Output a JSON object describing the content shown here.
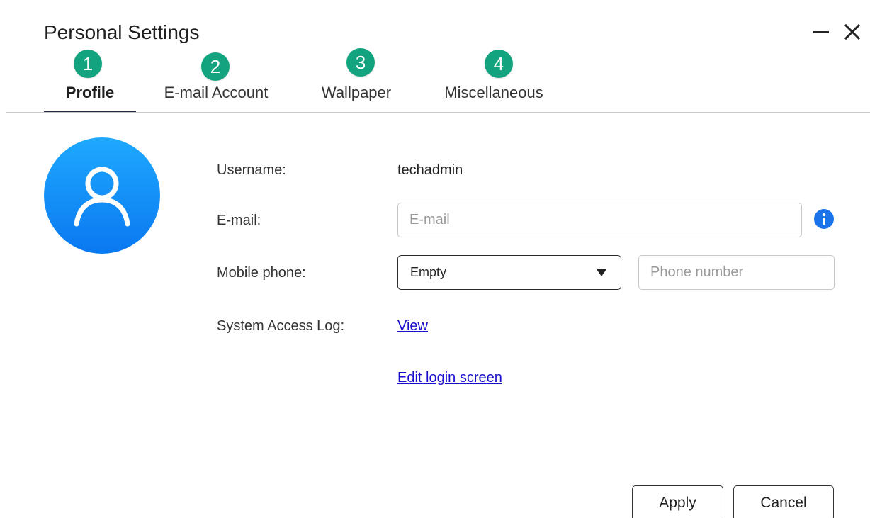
{
  "window": {
    "title": "Personal Settings"
  },
  "tabs": [
    {
      "label": "Profile",
      "marker": "1",
      "active": true
    },
    {
      "label": "E-mail Account",
      "marker": "2",
      "active": false
    },
    {
      "label": "Wallpaper",
      "marker": "3",
      "active": false
    },
    {
      "label": "Miscellaneous",
      "marker": "4",
      "active": false
    }
  ],
  "profile": {
    "username_label": "Username:",
    "username_value": "techadmin",
    "email_label": "E-mail:",
    "email_value": "",
    "email_placeholder": "E-mail",
    "mobile_label": "Mobile phone:",
    "mobile_country_selected": "Empty",
    "phone_value": "",
    "phone_placeholder": "Phone number",
    "access_log_label": "System Access Log:",
    "access_log_link": "View",
    "edit_login_link": "Edit login screen"
  },
  "footer": {
    "apply_label": "Apply",
    "cancel_label": "Cancel"
  },
  "colors": {
    "marker": "#14a37f",
    "avatar": "#0a8cf5",
    "link": "#1a0dcc",
    "info": "#1a73e8",
    "active_tab_underline": "#23253d"
  },
  "icons": {
    "minimize": "minimize-icon",
    "close": "close-icon",
    "avatar": "user-icon",
    "info": "info-icon",
    "dropdown": "caret-down-icon"
  }
}
